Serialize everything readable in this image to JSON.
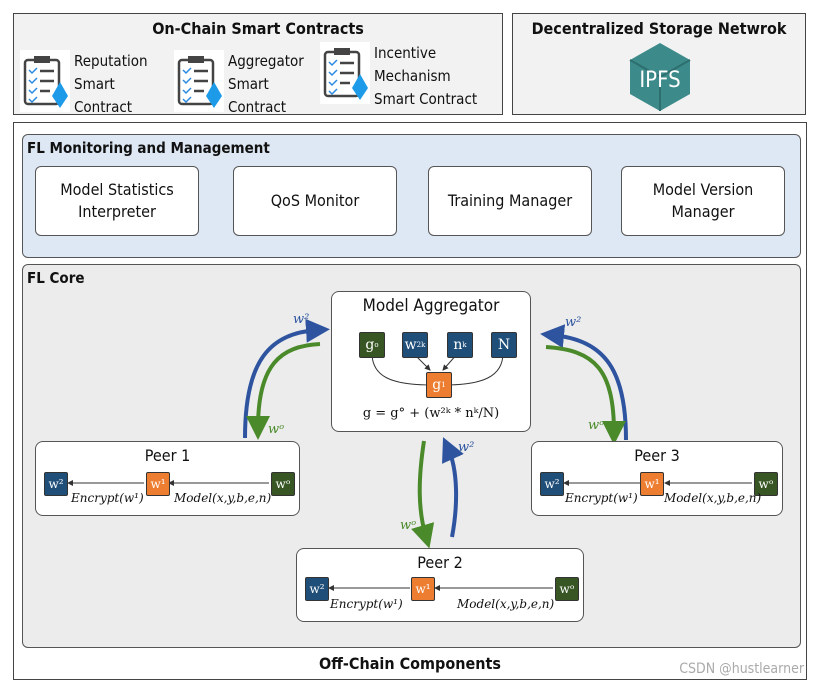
{
  "onchain": {
    "title": "On-Chain Smart Contracts",
    "contracts": [
      {
        "label": "Reputation\nSmart\nContract",
        "icon": "clipboard-ethereum-icon"
      },
      {
        "label": "Aggregator\nSmart\nContract",
        "icon": "clipboard-ethereum-icon"
      },
      {
        "label": "Incentive\nMechanism\nSmart Contract",
        "icon": "clipboard-ethereum-icon"
      }
    ]
  },
  "storage": {
    "title": "Decentralized Storage Netwrok",
    "logo_text": "IPFS",
    "logo_color": "#3d8a8a"
  },
  "offchain": {
    "title": "Off-Chain Components"
  },
  "monitoring": {
    "title": "FL Monitoring and Management",
    "modules": [
      "Model Statistics\nInterpreter",
      "QoS Monitor",
      "Training Manager",
      "Model Version\nManager"
    ]
  },
  "core": {
    "title": "FL Core",
    "aggregator": {
      "title": "Model Aggregator",
      "inputs": [
        {
          "base": "g",
          "sup": "o",
          "color": "green"
        },
        {
          "base": "w",
          "sup": "2k",
          "color": "blue"
        },
        {
          "base": "n",
          "sup": "k",
          "color": "blue"
        },
        {
          "base": "N",
          "sup": "",
          "color": "blue"
        }
      ],
      "output": {
        "base": "g",
        "sup": "1"
      },
      "formula": "g = g° + (w²ᵏ * nᵏ/N)"
    },
    "arrow_labels": {
      "up": "w²",
      "down": "wᵒ"
    },
    "peers": [
      {
        "title": "Peer 1",
        "w2": "w²",
        "w1": "w¹",
        "w0": "wᵒ",
        "encrypt": "Encrypt(w¹)",
        "model": "Model(x,y,b,e,n)"
      },
      {
        "title": "Peer 2",
        "w2": "w²",
        "w1": "w¹",
        "w0": "wᵒ",
        "encrypt": "Encrypt(w¹)",
        "model": "Model(x,y,b,e,n)"
      },
      {
        "title": "Peer 3",
        "w2": "w²",
        "w1": "w¹",
        "w0": "wᵒ",
        "encrypt": "Encrypt(w¹)",
        "model": "Model(x,y,b,e,n)"
      }
    ]
  },
  "colors": {
    "blue": "#1f4e79",
    "orange": "#ed7d31",
    "green": "#375623",
    "arrow_blue": "#2e54a0",
    "arrow_green": "#4a8a2a",
    "monitor_bg": "#dde8f4"
  },
  "watermark": "CSDN @hustlearner"
}
